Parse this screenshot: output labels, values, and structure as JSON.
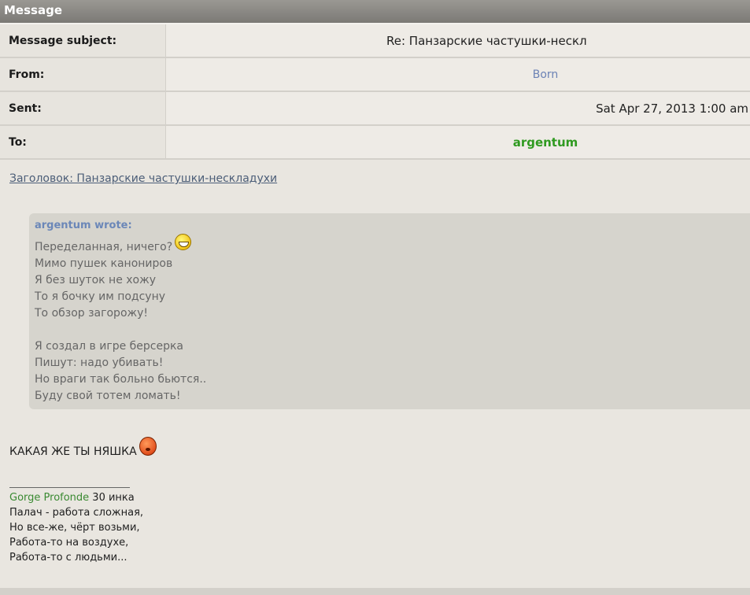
{
  "window": {
    "title": "Message"
  },
  "headers": {
    "subject_label": "Message subject:",
    "subject_value": "Re: Панзарские частушки-нескл",
    "from_label": "From:",
    "from_value": "Born",
    "sent_label": "Sent:",
    "sent_value": "Sat Apr 27, 2013 1:00 am",
    "to_label": "To:",
    "to_value": "argentum"
  },
  "body": {
    "subject_link": "Заголовок: Панзарские частушки-нескладухи",
    "quote": {
      "author": "argentum wrote:",
      "lines_a": [
        "Переделанная, ничего?",
        "Мимо пушек канониров",
        "Я без шуток не хожу",
        "То я бочку им подсуну",
        "То обзор загорожу!"
      ],
      "lines_b": [
        "Я создал в игре берсерка",
        "Пишут: надо убивать!",
        "Но враги так больно бьются..",
        "Буду свой тотем ломать!"
      ],
      "smiley_icon": "grin-smiley-icon"
    },
    "reply_text": "КАКАЯ ЖЕ ТЫ НЯШКА",
    "reply_smiley_icon": "angry-smiley-icon"
  },
  "signature": {
    "name": "Gorge Profonde",
    "rank": " 30 инка",
    "lines": [
      "Палач - работа сложная,",
      "Но все-же, чёрт возьми,",
      "Работа-то на воздухе,",
      "Работа-то с людьми..."
    ]
  },
  "colors": {
    "link_blue": "#6b82b5",
    "recipient_green": "#2f9a20",
    "quote_bg": "#d6d4cd"
  }
}
